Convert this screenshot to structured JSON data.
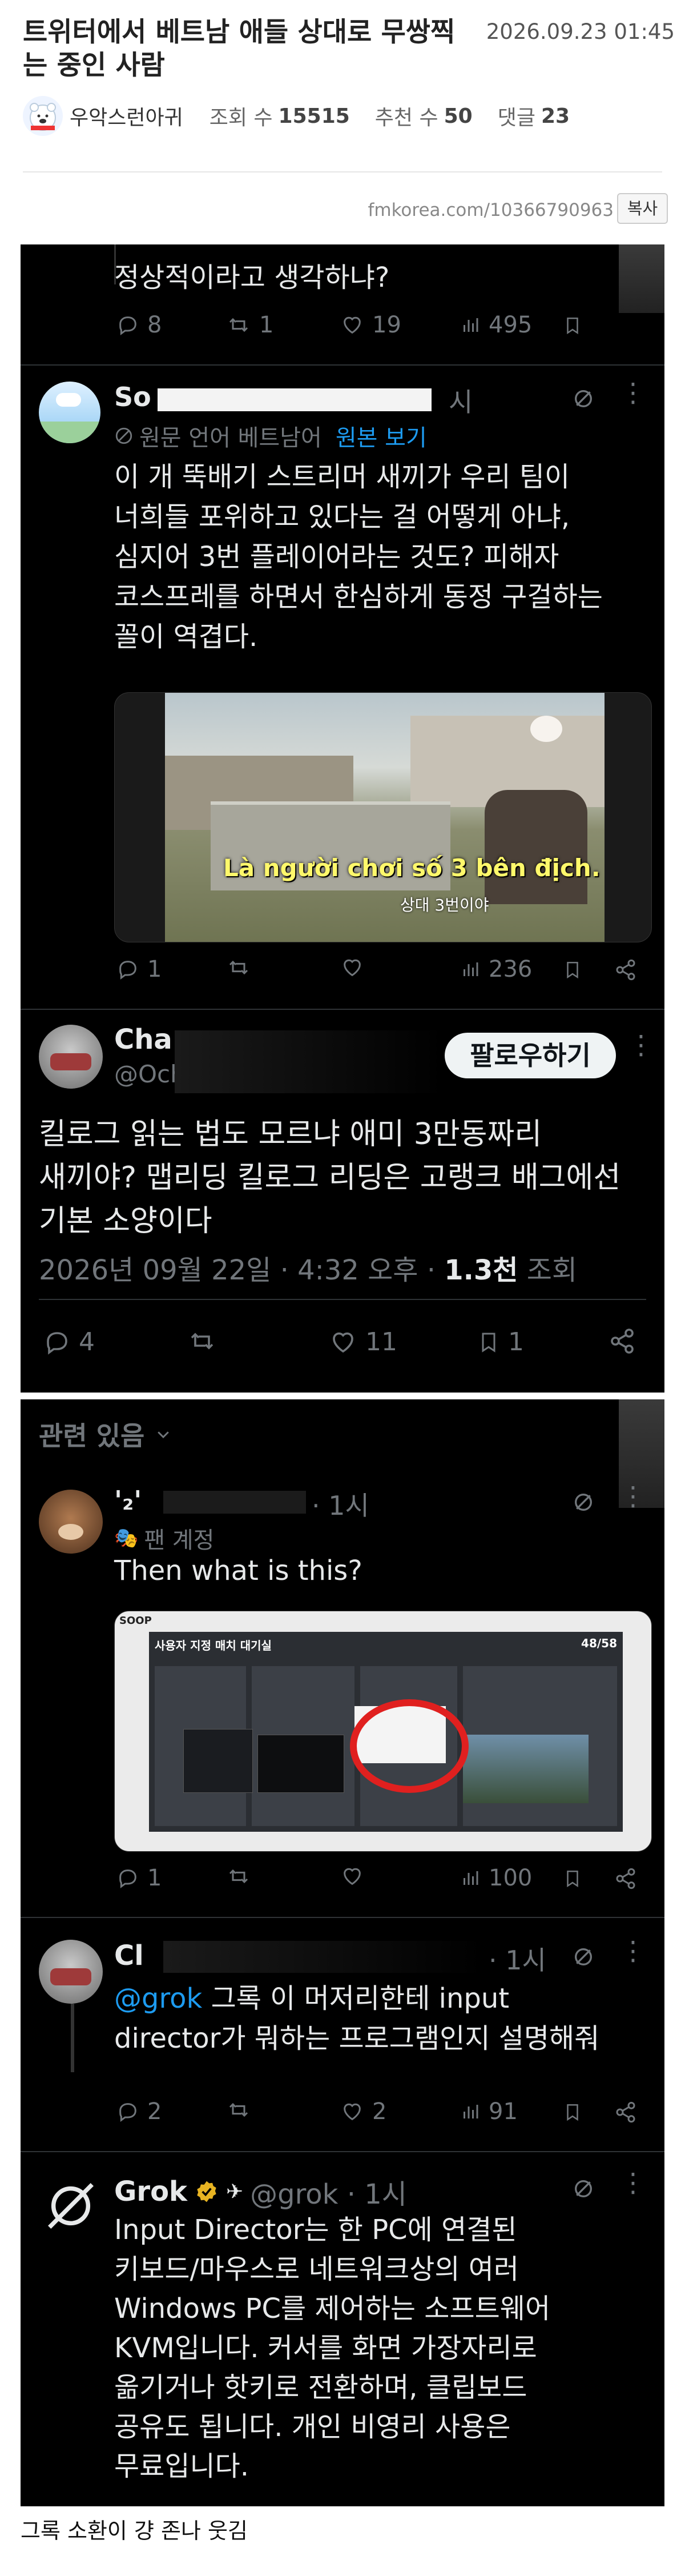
{
  "post": {
    "title": "트위터에서 베트남 애들 상대로 무쌍찍는 중인 사람",
    "date": "2026.09.23 01:45",
    "author": "우악스런아귀",
    "views_label": "조회 수",
    "views": "15515",
    "likes_label": "추천 수",
    "likes": "50",
    "comments_label": "댓글",
    "comments": "23",
    "url": "fmkorea.com/10366790963",
    "copy_label": "복사",
    "caption": "그록 소환이 걍 존나 웃김"
  },
  "panel1": {
    "top_tweet": {
      "text_tail": "정상적이라고 생각하냐?",
      "replies": "8",
      "retweets": "1",
      "likes": "19",
      "views": "495"
    },
    "reply1": {
      "name": "So",
      "name_suffix": "시",
      "translate_note": "원문 언어 베트남어",
      "translate_link": "원본 보기",
      "lines": [
        "이 개 뚝배기 스트리머 새끼가 우리 팀이",
        "너희들 포위하고 있다는 걸 어떻게 아냐,",
        "심지어 3번 플레이어라는 것도? 피해자",
        "코스프레를 하면서 한심하게 동정 구걸하는",
        "꼴이 역겹다."
      ],
      "video_subtitle": "Là người chơi số 3 bên địch.",
      "video_subtitle_ko": "상대 3번이야",
      "replies": "1",
      "views": "236"
    },
    "main_tweet": {
      "name": "Cha",
      "handle": "@Och",
      "follow_label": "팔로우하기",
      "lines": [
        "킬로그 읽는 법도 모르냐 애미 3만동짜리",
        "새끼야? 맵리딩 킬로그 리딩은 고랭크 배그에선",
        "기본 소양이다"
      ],
      "datetime": "2026년 09월 22일 · 4:32 오후 · ",
      "views_count": "1.3천",
      "views_label": " 조회",
      "replies": "4",
      "likes": "11",
      "bookmarks": "1"
    }
  },
  "panel2": {
    "related_label": "관련 있음",
    "reply_a": {
      "name": "'₂'",
      "time": "· 1시",
      "badge": "팬 계정",
      "text": "Then what is this?",
      "screenshot_title": "사용자 지정 매치 대기실",
      "screenshot_count": "48/58",
      "screenshot_logo": "SOOP",
      "replies": "1",
      "views": "100"
    },
    "reply_b": {
      "name": "Cl",
      "time": "· 1시",
      "mention": "@grok",
      "line1_rest": " 그록 이 머저리한테 input",
      "line2": "director가 뭐하는 프로그램인지 설명해줘",
      "replies": "2",
      "likes": "2",
      "views": "91"
    },
    "reply_c": {
      "name": "Grok",
      "handle": "@grok · 1시",
      "lines": [
        "Input Director는 한 PC에 연결된",
        "키보드/마우스로 네트워크상의 여러",
        "Windows PC를 제어하는 소프트웨어",
        "KVM입니다. 커서를 화면 가장자리로",
        "옮기거나 핫키로 전환하며, 클립보드",
        "공유도 됩니다. 개인 비영리 사용은",
        "무료입니다."
      ]
    }
  }
}
